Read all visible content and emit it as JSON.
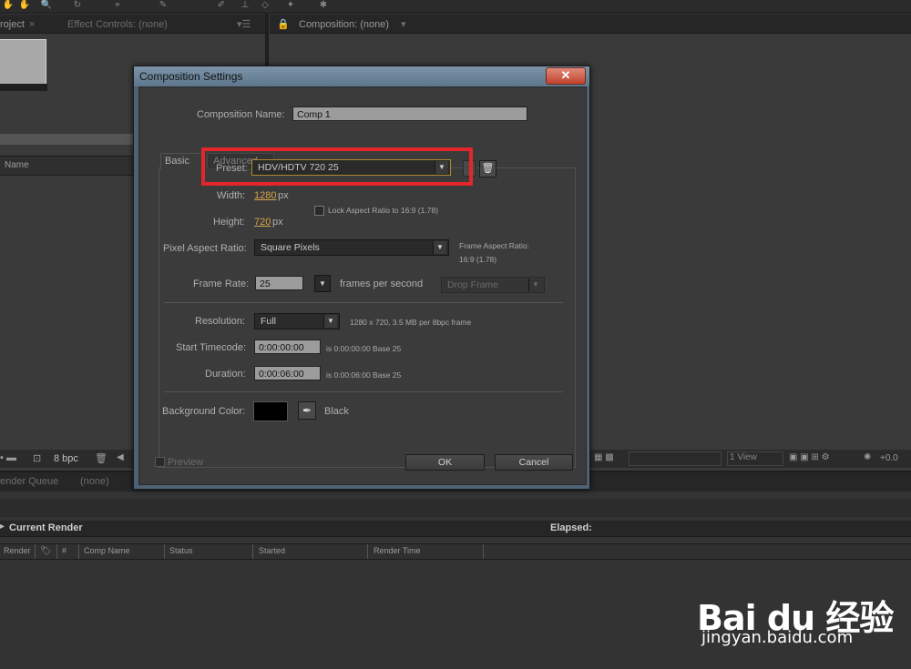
{
  "background": {
    "tabs": {
      "project": "roject",
      "effect_controls": "Effect Controls: (none)",
      "composition": "Composition: (none)"
    },
    "project_panel": {
      "name_column": "Name",
      "bpc": "8 bpc"
    },
    "viewer_footer": {
      "view": "1 View",
      "exposure": "+0.0"
    },
    "render_queue": {
      "tab_render_queue": "ender Queue",
      "tab_none": "(none)",
      "current_render": "Current Render",
      "elapsed": "Elapsed:",
      "columns": [
        "Render",
        "#",
        "Comp Name",
        "Status",
        "Started",
        "Render Time"
      ]
    }
  },
  "dialog": {
    "title": "Composition Settings",
    "close_glyph": "✕",
    "composition_name": {
      "label": "Composition Name:",
      "value": "Comp 1"
    },
    "tabs": [
      "Basic",
      "Advanced"
    ],
    "preset": {
      "label": "Preset:",
      "value": "HDV/HDTV 720 25"
    },
    "width": {
      "label": "Width:",
      "value": "1280",
      "unit": "px"
    },
    "height": {
      "label": "Height:",
      "value": "720",
      "unit": "px"
    },
    "lock_aspect": {
      "label": "Lock Aspect Ratio to 16:9 (1.78)",
      "checked": false
    },
    "pixel_aspect": {
      "label": "Pixel Aspect Ratio:",
      "value": "Square Pixels",
      "frame_aspect_label": "Frame Aspect Ratio:",
      "frame_aspect_value": "16:9 (1.78)"
    },
    "frame_rate": {
      "label": "Frame Rate:",
      "value": "25",
      "unit": "frames per second",
      "drop_frame": "Drop Frame"
    },
    "resolution": {
      "label": "Resolution:",
      "value": "Full",
      "info": "1280 x 720, 3.5 MB per 8bpc frame"
    },
    "start_timecode": {
      "label": "Start Timecode:",
      "value": "0:00:00:00",
      "info": "is 0:00:00:00  Base 25"
    },
    "duration": {
      "label": "Duration:",
      "value": "0:00:06:00",
      "info": "is 0:00:06:00  Base 25"
    },
    "background_color": {
      "label": "Background Color:",
      "color": "#000000",
      "name": "Black"
    },
    "preview_label": "Preview",
    "ok_label": "OK",
    "cancel_label": "Cancel"
  },
  "colors": {
    "highlight": "#e2262b",
    "link": "#d4a34a"
  },
  "watermark": {
    "logo": "Bai du 经验",
    "url": "jingyan.baidu.com"
  }
}
